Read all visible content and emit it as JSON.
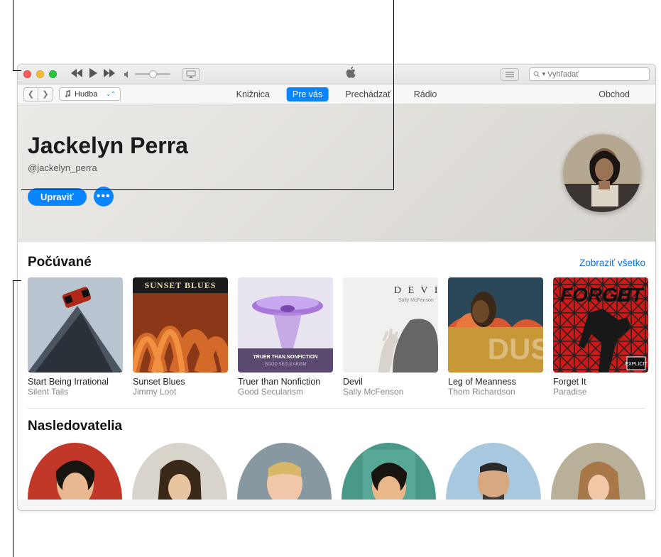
{
  "titlebar": {
    "search_placeholder": "Vyhľadať"
  },
  "sourcebar": {
    "picker_label": "Hudba",
    "tabs": {
      "library": "Knižnica",
      "for_you": "Pre vás",
      "browse": "Prechádzať",
      "radio": "Rádio"
    },
    "store": "Obchod"
  },
  "profile": {
    "name": "Jackelyn Perra",
    "handle": "@jackelyn_perra",
    "edit_label": "Upraviť"
  },
  "listening": {
    "title": "Počúvané",
    "see_all": "Zobraziť všetko",
    "albums": [
      {
        "title": "Start Being Irrational",
        "artist": "Silent Tails"
      },
      {
        "title": "Sunset Blues",
        "artist": "Jimmy Loot"
      },
      {
        "title": "Truer than Nonfiction",
        "artist": "Good Secularism"
      },
      {
        "title": "Devil",
        "artist": "Sally McFenson"
      },
      {
        "title": "Leg of Meanness",
        "artist": "Thom Richardson"
      },
      {
        "title": "Forget It",
        "artist": "Paradise"
      }
    ]
  },
  "followers": {
    "title": "Nasledovatelia"
  }
}
